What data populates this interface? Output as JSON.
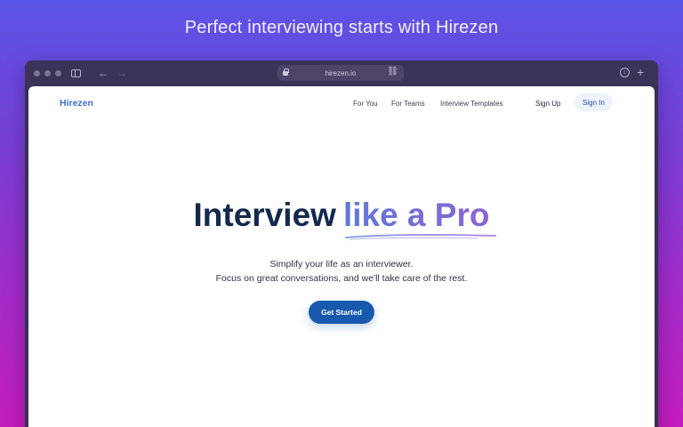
{
  "headline": "Perfect interviewing starts with Hirezen",
  "browser": {
    "url": "hirezen.io",
    "icons": [
      "sidebar-icon",
      "back-arrow-icon",
      "forward-arrow-icon",
      "lock-icon",
      "link-icon",
      "download-icon",
      "plus-icon"
    ]
  },
  "site": {
    "logo": "Hirezen",
    "nav": {
      "for_you": "For You",
      "for_teams": "For Teams",
      "templates": "Interview Templates",
      "sign_up": "Sign Up",
      "sign_in": "Sign In"
    },
    "hero": {
      "title_main": "Interview",
      "title_accent": "like a Pro",
      "subtitle_line1": "Simplify your life as an interviewer.",
      "subtitle_line2": "Focus on great conversations, and we'll take care of the rest.",
      "cta": "Get Started"
    }
  },
  "colors": {
    "accent": "#1659ad",
    "logo": "#3b6fd1",
    "hero_text": "#14294d",
    "gradient_start": "#5a54e6",
    "gradient_end": "#c51dbd"
  }
}
